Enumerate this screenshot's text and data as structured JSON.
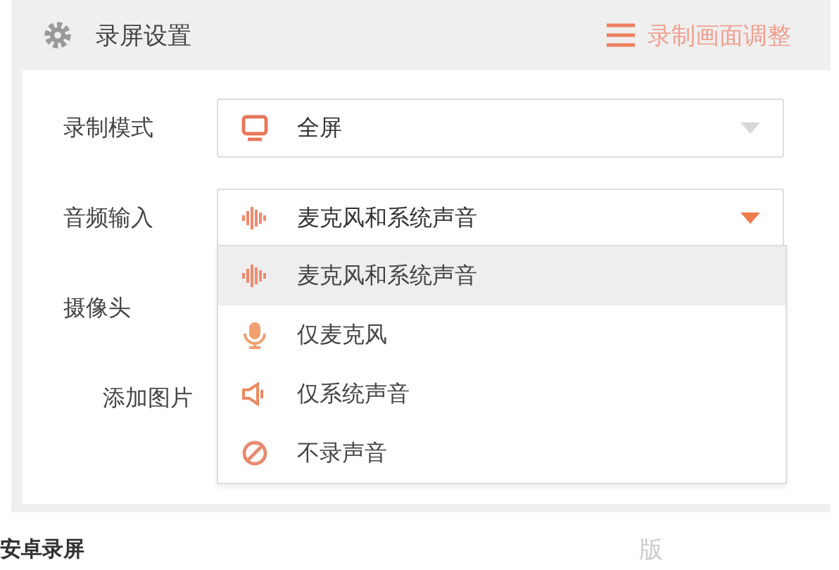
{
  "header": {
    "title": "录屏设置",
    "action": "录制画面调整"
  },
  "fields": [
    {
      "label": "录制模式",
      "value": "全屏",
      "kind": "monitor",
      "open": false
    },
    {
      "label": "音频输入",
      "value": "麦克风和系统声音",
      "kind": "wave",
      "open": true
    }
  ],
  "dropdown": [
    {
      "label": "麦克风和系统声音",
      "kind": "wave",
      "selected": true
    },
    {
      "label": "仅麦克风",
      "kind": "mic",
      "selected": false
    },
    {
      "label": "仅系统声音",
      "kind": "speaker",
      "selected": false
    },
    {
      "label": "不录声音",
      "kind": "mute",
      "selected": false
    }
  ],
  "camera_label": "摄像头",
  "add_image_label": "添加图片",
  "footer": {
    "app_name": "安卓录屏",
    "version_text": "版"
  }
}
